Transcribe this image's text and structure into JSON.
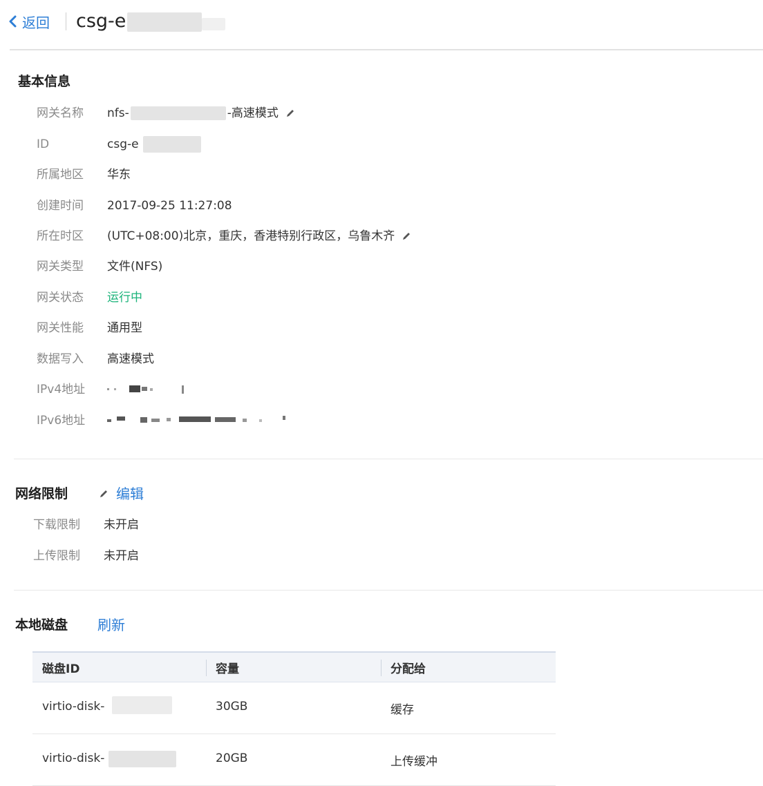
{
  "header": {
    "back_label": "返回",
    "gateway_title": "csg-e"
  },
  "basic_info": {
    "title": "基本信息",
    "rows": [
      {
        "label": "网关名称",
        "value_prefix": "nfs-",
        "value_suffix": "-高速模式"
      },
      {
        "label": "ID",
        "value": "csg-e"
      },
      {
        "label": "所属地区",
        "value": "华东"
      },
      {
        "label": "创建时间",
        "value": "2017-09-25 11:27:08"
      },
      {
        "label": "所在时区",
        "value": "(UTC+08:00)北京，重庆，香港特别行政区，乌鲁木齐"
      },
      {
        "label": "网关类型",
        "value": "文件(NFS)"
      },
      {
        "label": "网关状态",
        "value": "运行中"
      },
      {
        "label": "网关性能",
        "value": "通用型"
      },
      {
        "label": "数据写入",
        "value": "高速模式"
      },
      {
        "label": "IPv4地址",
        "value": ""
      },
      {
        "label": "IPv6地址",
        "value": ""
      }
    ]
  },
  "network_limit": {
    "title": "网络限制",
    "edit_label": "编辑",
    "rows": [
      {
        "label": "下载限制",
        "value": "未开启"
      },
      {
        "label": "上传限制",
        "value": "未开启"
      }
    ]
  },
  "local_disk": {
    "title": "本地磁盘",
    "refresh_label": "刷新",
    "columns": [
      "磁盘ID",
      "容量",
      "分配给"
    ],
    "rows": [
      {
        "disk_id": "virtio-disk-",
        "capacity": "30GB",
        "assigned": "缓存"
      },
      {
        "disk_id": "virtio-disk-",
        "capacity": "20GB",
        "assigned": "上传缓冲"
      }
    ]
  },
  "colors": {
    "accent": "#2d7ed6",
    "status_running": "#1bb37a"
  }
}
